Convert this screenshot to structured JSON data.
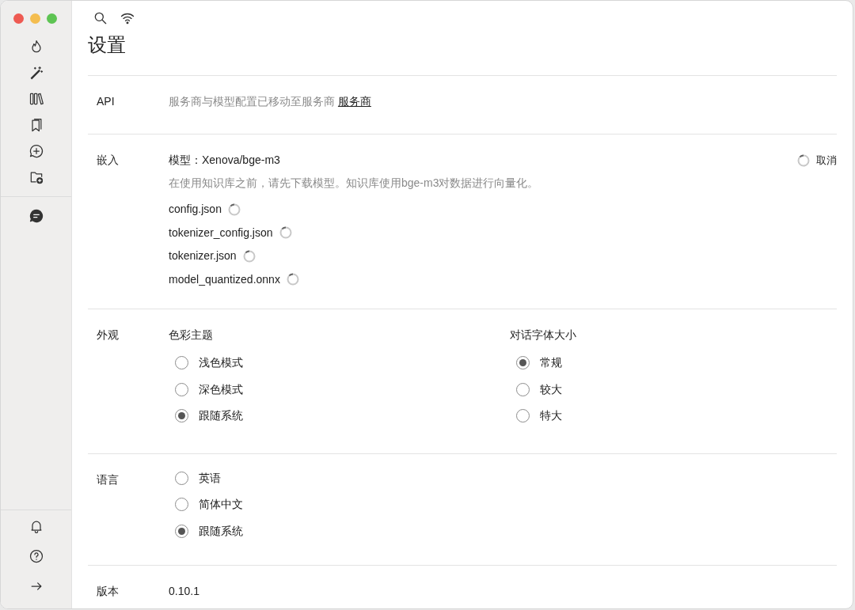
{
  "page": {
    "title": "设置"
  },
  "api": {
    "label": "API",
    "text": "服务商与模型配置已移动至服务商",
    "link": "服务商"
  },
  "embedding": {
    "label": "嵌入",
    "model": "模型：Xenova/bge-m3",
    "description": "在使用知识库之前，请先下载模型。知识库使用bge-m3对数据进行向量化。",
    "cancel": "取消",
    "files": [
      {
        "name": "config.json"
      },
      {
        "name": "tokenizer_config.json"
      },
      {
        "name": "tokenizer.json"
      },
      {
        "name": "model_quantized.onnx"
      }
    ]
  },
  "appearance": {
    "label": "外观",
    "groups": [
      {
        "title": "色彩主题",
        "options": [
          {
            "label": "浅色模式",
            "selected": false
          },
          {
            "label": "深色模式",
            "selected": false
          },
          {
            "label": "跟随系统",
            "selected": true
          }
        ]
      },
      {
        "title": "对话字体大小",
        "options": [
          {
            "label": "常规",
            "selected": true
          },
          {
            "label": "较大",
            "selected": false
          },
          {
            "label": "特大",
            "selected": false
          }
        ]
      }
    ]
  },
  "language": {
    "label": "语言",
    "options": [
      {
        "label": "英语",
        "selected": false
      },
      {
        "label": "简体中文",
        "selected": false
      },
      {
        "label": "跟随系统",
        "selected": true
      }
    ]
  },
  "version": {
    "label": "版本",
    "value": "0.10.1"
  }
}
